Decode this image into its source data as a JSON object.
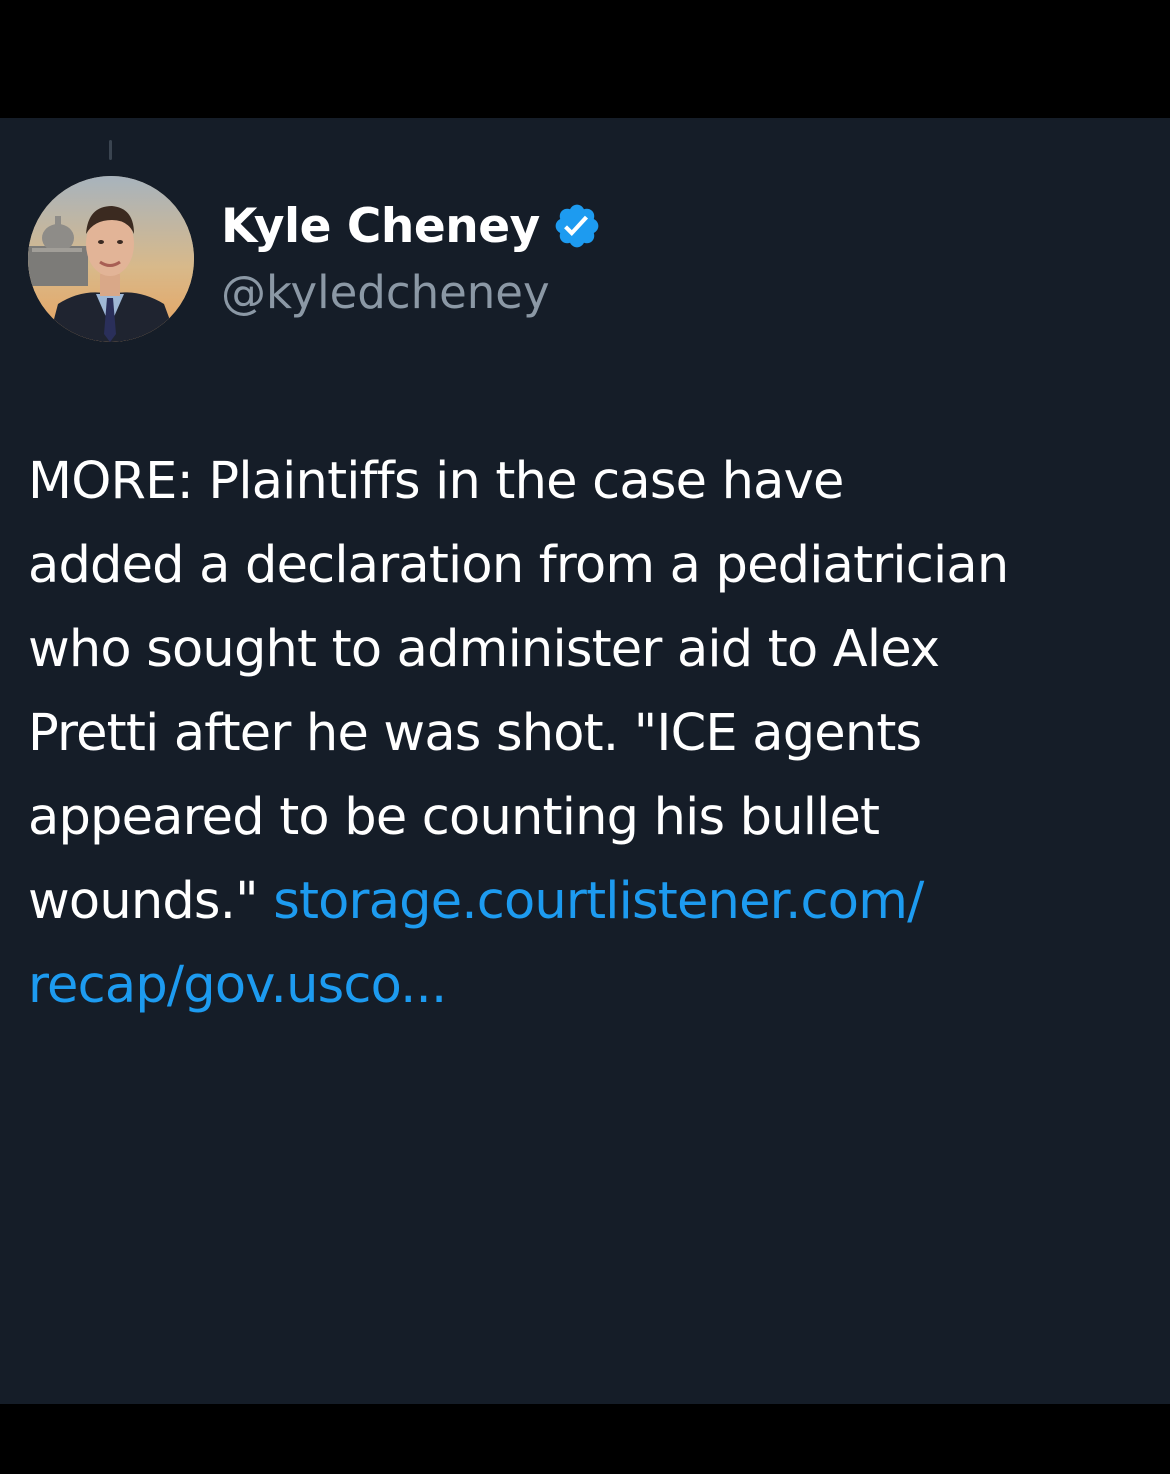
{
  "tweet": {
    "author": {
      "display_name": "Kyle Cheney",
      "handle": "@kyledcheney",
      "verified_icon": "verified-badge-icon",
      "verified_color": "#1d9bf0"
    },
    "body_lines": [
      "MORE: Plaintiffs in the case have",
      "added a declaration from a pediatrician",
      "who sought to administer aid to Alex",
      "Pretti after he was shot.  \"ICE agents",
      "appeared to be counting his bullet",
      "wounds.\" "
    ],
    "link_line_1": "storage.courtlistener.com/",
    "link_line_2": "recap/gov.usco..."
  },
  "colors": {
    "background": "#151d28",
    "letterbox": "#000000",
    "text": "#ffffff",
    "secondary_text": "#8b98a5",
    "link": "#1d9bf0"
  }
}
